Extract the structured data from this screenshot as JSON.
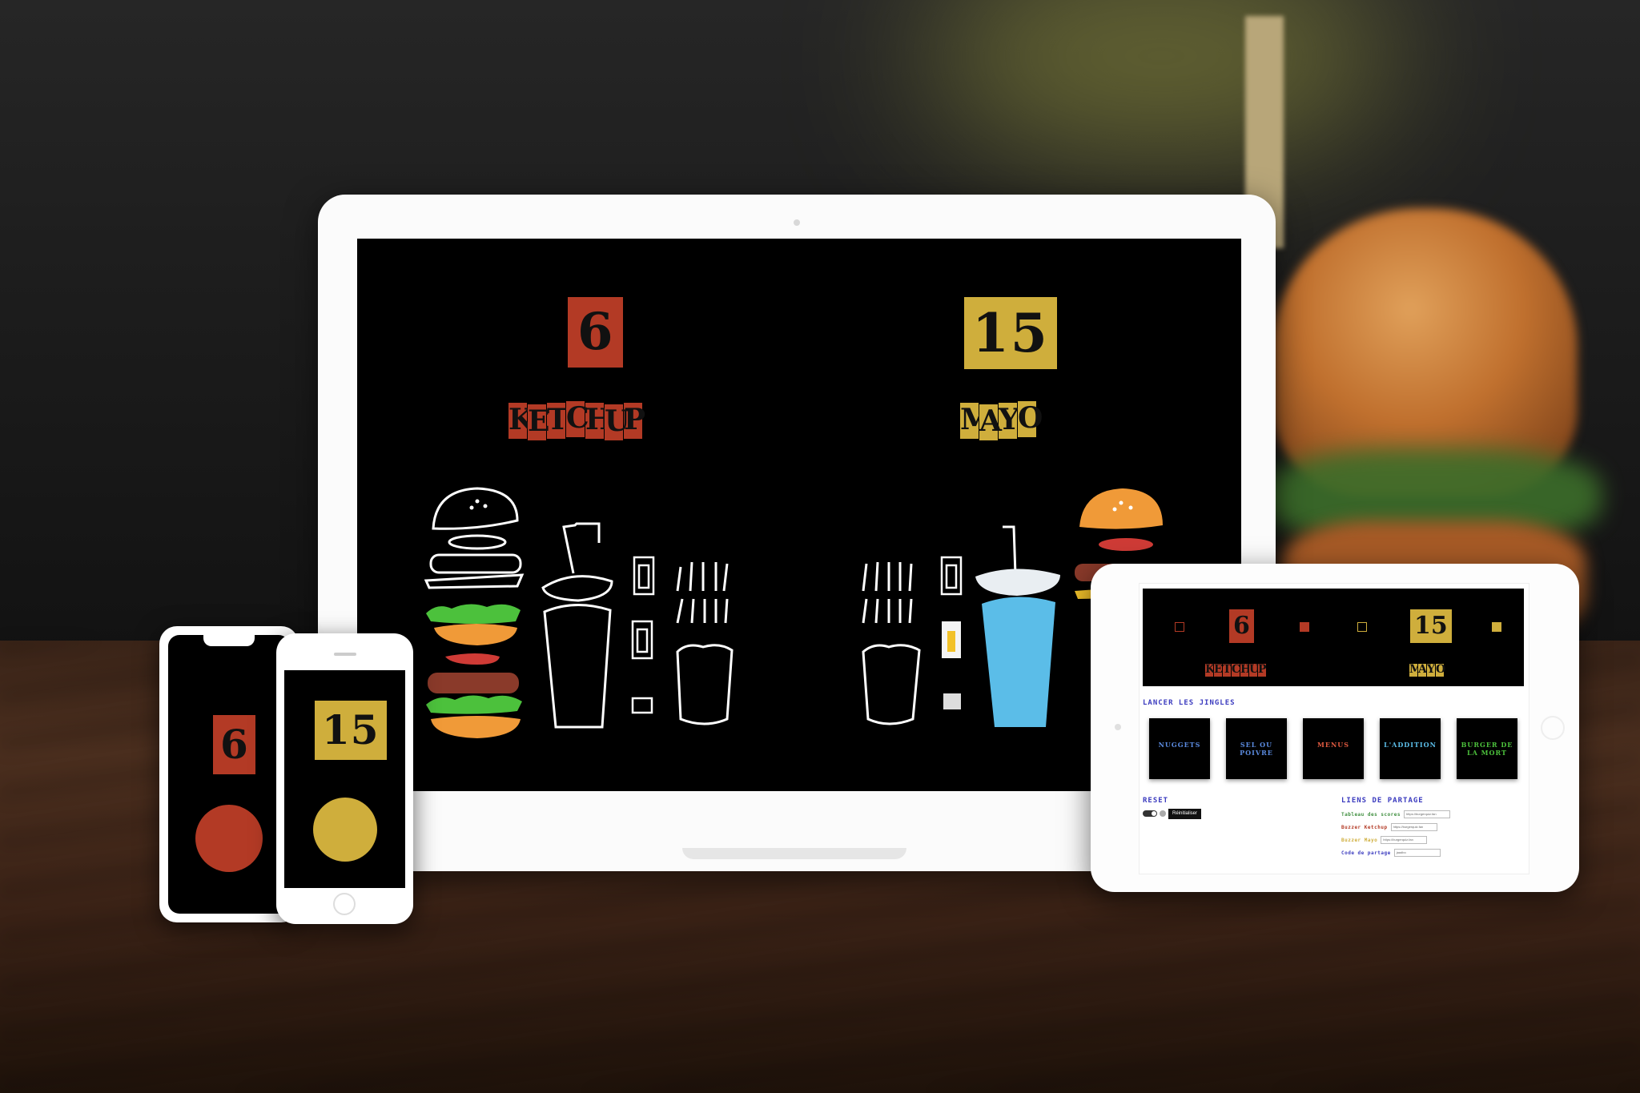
{
  "laptop_app": {
    "team_left": {
      "score": "6",
      "name_letters": [
        "K",
        "E",
        "T",
        "C",
        "H",
        "U",
        "P"
      ],
      "color": "#b33a25"
    },
    "team_right": {
      "score": "15",
      "name_letters": [
        "M",
        "A",
        "Y",
        "O"
      ],
      "color": "#cfae3c"
    }
  },
  "phone_left": {
    "score": "6",
    "button_color": "#b33a25"
  },
  "phone_right": {
    "score": "15",
    "button_color": "#cfae3c"
  },
  "tablet_admin": {
    "team_left": {
      "score": "6",
      "name_letters": [
        "K",
        "E",
        "T",
        "C",
        "H",
        "U",
        "P"
      ]
    },
    "team_right": {
      "score": "15",
      "name_letters": [
        "M",
        "A",
        "Y",
        "O"
      ]
    },
    "jingles_heading": "Lancer les jingles",
    "jingles": [
      {
        "label": "NUGGETS"
      },
      {
        "label": "SEL OU POIVRE"
      },
      {
        "label": "MENUS"
      },
      {
        "label": "L'ADDITION"
      },
      {
        "label": "BURGER DE LA MORT"
      }
    ],
    "reset_heading": "Reset",
    "reset_button": "Réinitialiser",
    "share_heading": "Liens de partage",
    "share_links": [
      {
        "label": "Tableau des scores",
        "value": "https://burgerquiz.fan",
        "color": "#3f8f3f"
      },
      {
        "label": "Buzzer Ketchup",
        "value": "https://burgerquiz.fan",
        "color": "#b33a25"
      },
      {
        "label": "Buzzer Mayo",
        "value": "https://burgerquiz.fan",
        "color": "#cfae3c"
      },
      {
        "label": "Code de partage",
        "value": "jaadbo",
        "color": "#3b3bbf"
      }
    ]
  }
}
